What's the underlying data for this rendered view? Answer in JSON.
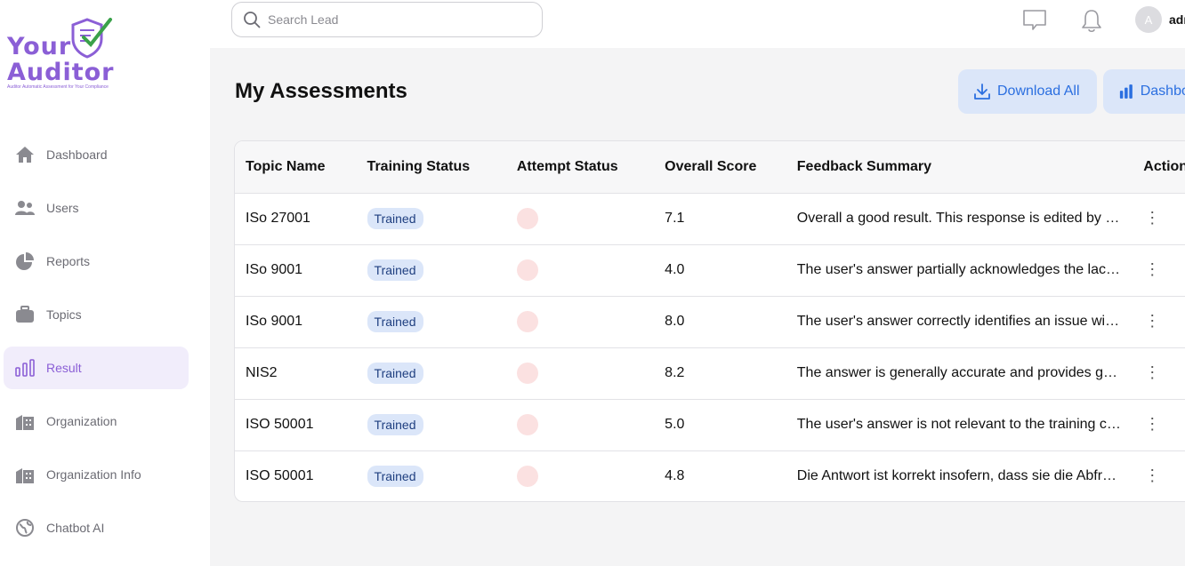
{
  "brand": {
    "line1": "Your",
    "line2": "Auditor",
    "tagline": "Auditor Automatic Assessment for Your Compliance",
    "color": "#8b5fd6",
    "check_color": "#3aa14a"
  },
  "sidebar": {
    "items": [
      {
        "label": "Dashboard",
        "icon": "home-icon",
        "active": false
      },
      {
        "label": "Users",
        "icon": "users-icon",
        "active": false
      },
      {
        "label": "Reports",
        "icon": "pie-chart-icon",
        "active": false
      },
      {
        "label": "Topics",
        "icon": "briefcase-icon",
        "active": false
      },
      {
        "label": "Result",
        "icon": "bar-chart-icon",
        "active": true
      },
      {
        "label": "Organization",
        "icon": "building-icon",
        "active": false
      },
      {
        "label": "Organization Info",
        "icon": "building-icon",
        "active": false
      },
      {
        "label": "Chatbot AI",
        "icon": "globe-icon",
        "active": false
      }
    ]
  },
  "topbar": {
    "search_placeholder": "Search Lead",
    "avatar_initial": "A",
    "username": "admin"
  },
  "main": {
    "title": "My Assessments",
    "download_label": "Download All",
    "dashboard_label": "Dashboard"
  },
  "table": {
    "headers": [
      "Topic Name",
      "Training Status",
      "Attempt Status",
      "Overall Score",
      "Feedback Summary",
      "Actions"
    ],
    "rows": [
      {
        "topic": "ISo 27001",
        "status": "Trained",
        "score": "7.1",
        "feedback": "Overall a good result. This response is edited by the auditor"
      },
      {
        "topic": "ISo 9001",
        "status": "Trained",
        "score": "4.0",
        "feedback": "The user's answer partially acknowledges the lack of documentation"
      },
      {
        "topic": "ISo 9001",
        "status": "Trained",
        "score": "8.0",
        "feedback": "The user's answer correctly identifies an issue with the process"
      },
      {
        "topic": "NIS2",
        "status": "Trained",
        "score": "8.2",
        "feedback": "The answer is generally accurate and provides good detail"
      },
      {
        "topic": "ISO 50001",
        "status": "Trained",
        "score": "5.0",
        "feedback": "The user's answer is not relevant to the training content"
      },
      {
        "topic": "ISO 50001",
        "status": "Trained",
        "score": "4.8",
        "feedback": "Die Antwort ist korrekt insofern, dass sie die Abfrage beantwortet"
      }
    ]
  },
  "colors": {
    "accent": "#2b6fe0",
    "active_nav_bg": "#f1edfb",
    "badge_bg": "#dbe6f9",
    "attempt_dot": "#fbe1e1"
  }
}
